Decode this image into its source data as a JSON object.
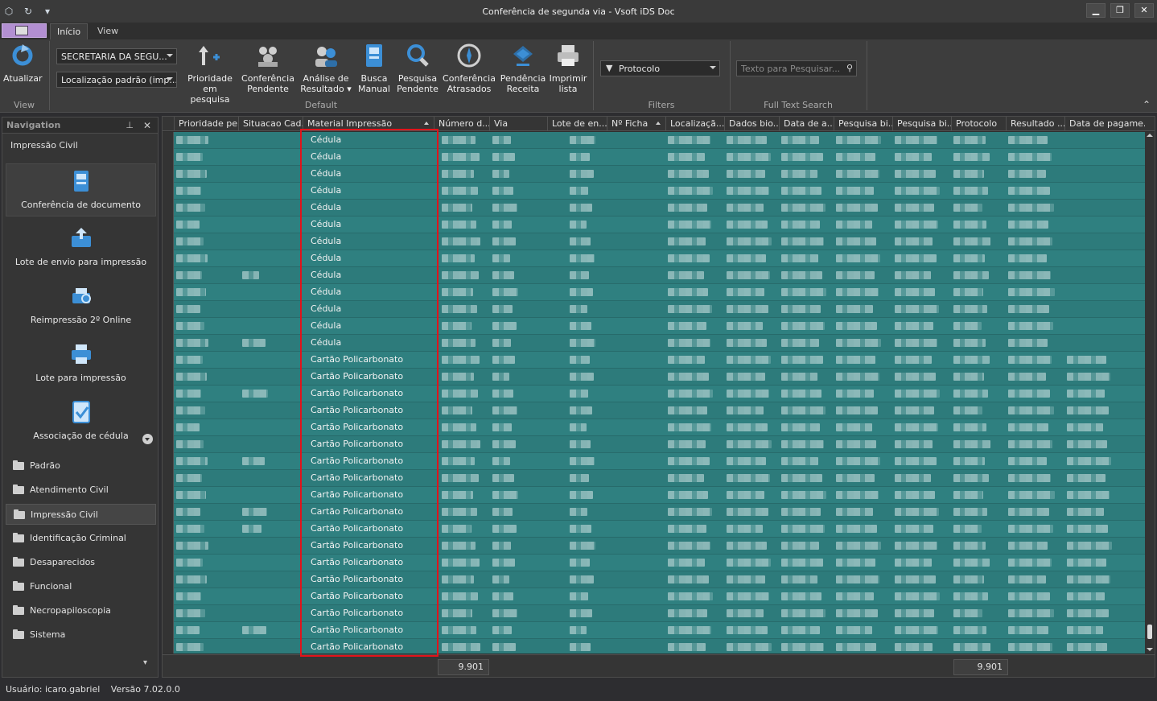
{
  "window": {
    "title": "Conferência de segunda via - Vsoft iDS Doc",
    "controls": {
      "minimize": "▁",
      "restore": "❐",
      "close": "✕"
    }
  },
  "ribbon": {
    "tabs": [
      {
        "label": "Início",
        "active": true
      },
      {
        "label": "View",
        "active": false
      }
    ],
    "groups": {
      "view": "View",
      "default": "Default",
      "filters": "Filters",
      "full_text_search": "Full Text Search"
    },
    "refresh_label": "Atualizar",
    "secretaria_combo": "SECRETARIA DA SEGU...",
    "location_combo": "Localização padrão (imp...",
    "buttons": [
      {
        "label1": "Prioridade",
        "label2": "em pesquisa",
        "icon": "priority-icon"
      },
      {
        "label1": "Conferência",
        "label2": "Pendente",
        "icon": "pending-check-icon"
      },
      {
        "label1": "Análise de",
        "label2": "Resultado ▾",
        "icon": "result-analysis-icon"
      },
      {
        "label1": "Busca",
        "label2": "Manual",
        "icon": "manual-search-icon"
      },
      {
        "label1": "Pesquisa",
        "label2": "Pendente",
        "icon": "pending-search-icon"
      },
      {
        "label1": "Conferência",
        "label2": "Atrasados",
        "icon": "overdue-icon"
      },
      {
        "label1": "Pendência",
        "label2": "Receita",
        "icon": "revenue-icon"
      },
      {
        "label1": "Imprimir",
        "label2": "lista",
        "icon": "print-icon"
      }
    ],
    "filter_combo": "Protocolo",
    "search_placeholder": "Texto para Pesquisar..."
  },
  "navigation": {
    "header": "Navigation",
    "group_title": "Impressão Civil",
    "big_items": [
      {
        "label": "Conferência de documento",
        "icon": "document-check-icon",
        "selected": true
      },
      {
        "label": "Lote de envio para impressão",
        "icon": "send-batch-icon",
        "selected": false
      },
      {
        "label": "Reimpressão 2º Online",
        "icon": "reprint-icon",
        "selected": false
      },
      {
        "label": "Lote para impressão",
        "icon": "print-batch-icon",
        "selected": false
      },
      {
        "label": "Associação de cédula",
        "icon": "ballot-association-icon",
        "selected": false
      }
    ],
    "folders": [
      {
        "label": "Padrão",
        "selected": false
      },
      {
        "label": "Atendimento Civil",
        "selected": false
      },
      {
        "label": "Impressão Civil",
        "selected": true
      },
      {
        "label": "Identificação Criminal",
        "selected": false
      },
      {
        "label": "Desaparecidos",
        "selected": false
      },
      {
        "label": "Funcional",
        "selected": false
      },
      {
        "label": "Necropapiloscopia",
        "selected": false
      },
      {
        "label": "Sistema",
        "selected": false
      }
    ]
  },
  "grid": {
    "columns": [
      "Prioridade pe...",
      "Situacao Cad...",
      "Material Impressão",
      "Número d...",
      "Via",
      "Lote de en...",
      "Nº Ficha",
      "Localizaçã...",
      "Dados bio...",
      "Data de a...",
      "Pesquisa bi...",
      "Pesquisa bi...",
      "Protocolo",
      "Resultado ...",
      "Data de pagame..."
    ],
    "material_values": [
      "Cédula",
      "Cédula",
      "Cédula",
      "Cédula",
      "Cédula",
      "Cédula",
      "Cédula",
      "Cédula",
      "Cédula",
      "Cédula",
      "Cédula",
      "Cédula",
      "Cédula",
      "Cartão Policarbonato",
      "Cartão Policarbonato",
      "Cartão Policarbonato",
      "Cartão Policarbonato",
      "Cartão Policarbonato",
      "Cartão Policarbonato",
      "Cartão Policarbonato",
      "Cartão Policarbonato",
      "Cartão Policarbonato",
      "Cartão Policarbonato",
      "Cartão Policarbonato",
      "Cartão Policarbonato",
      "Cartão Policarbonato",
      "Cartão Policarbonato",
      "Cartão Policarbonato",
      "Cartão Policarbonato",
      "Cartão Policarbonato",
      "Cartão Policarbonato"
    ],
    "footer_sum_1": "9.901",
    "footer_sum_2": "9.901"
  },
  "status": {
    "user": "Usuário: icaro.gabriel",
    "version": "Versão 7.02.0.0"
  },
  "colors": {
    "grid_row": "#2d7b7b",
    "highlight_border": "#e0141b",
    "app_button": "#b28fd1"
  }
}
